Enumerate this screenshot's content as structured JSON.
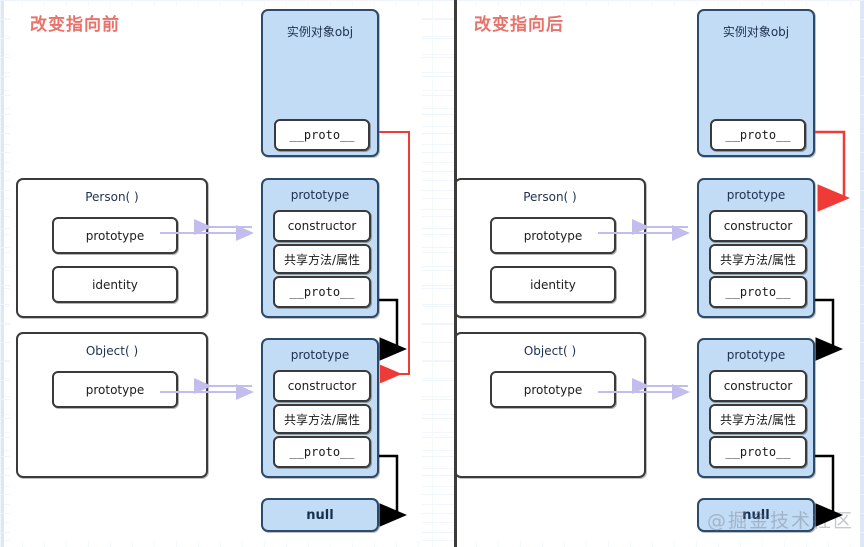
{
  "panels": [
    {
      "id": "before",
      "title": "改变指向前",
      "obj": {
        "header": "实例对象obj",
        "proto_field": "__proto__"
      },
      "person": {
        "header": "Person( )",
        "fields": [
          "prototype",
          "identity"
        ]
      },
      "object": {
        "header": "Object( )",
        "fields": [
          "prototype"
        ]
      },
      "person_prototype": {
        "header": "prototype",
        "fields": [
          "constructor",
          "共享方法/属性",
          "__proto__"
        ]
      },
      "object_prototype": {
        "header": "prototype",
        "fields": [
          "constructor",
          "共享方法/属性",
          "__proto__"
        ]
      },
      "null_box": {
        "label": "null"
      },
      "arrows": {
        "obj_proto_target": "Object.prototype",
        "person_proto_proto_target": "Object.prototype",
        "object_proto_proto_target": "null"
      }
    },
    {
      "id": "after",
      "title": "改变指向后",
      "obj": {
        "header": "实例对象obj",
        "proto_field": "__proto__"
      },
      "person": {
        "header": "Person( )",
        "fields": [
          "prototype",
          "identity"
        ]
      },
      "object": {
        "header": "Object( )",
        "fields": [
          "prototype"
        ]
      },
      "person_prototype": {
        "header": "prototype",
        "fields": [
          "constructor",
          "共享方法/属性",
          "__proto__"
        ]
      },
      "object_prototype": {
        "header": "prototype",
        "fields": [
          "constructor",
          "共享方法/属性",
          "__proto__"
        ]
      },
      "null_box": {
        "label": "null"
      },
      "arrows": {
        "obj_proto_target": "Person.prototype",
        "person_proto_proto_target": "Object.prototype",
        "object_proto_proto_target": "null"
      }
    }
  ],
  "watermark": "@掘金技术社区",
  "colors": {
    "title": "#e8736a",
    "blue_fill": "#c2dcf6",
    "blue_border": "#2c4a6b",
    "box_border": "#3a3a3a",
    "red_arrow": "#ef3b37",
    "black_arrow": "#000000",
    "purple_arrow": "#c3bdee",
    "divider": "#3c3c3c"
  }
}
